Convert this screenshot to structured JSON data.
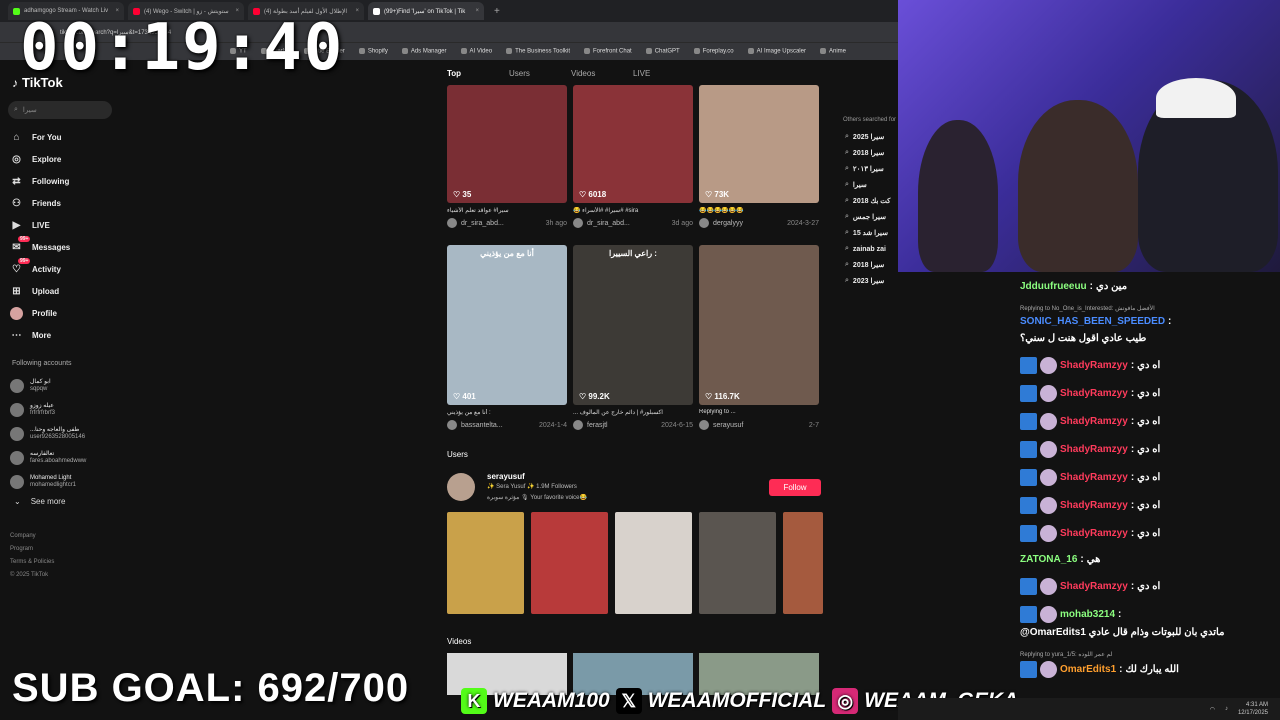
{
  "browser": {
    "tabs": [
      {
        "label": "adhamgogo Stream - Watch Liv",
        "color": "#53fc18"
      },
      {
        "label": "(4) Wego - Switch | ستويتش - زو",
        "color": "#ff0033"
      },
      {
        "label": "(4) الإطلال الأول لفيلم أسد بطولة",
        "color": "#ff0033"
      },
      {
        "label": "(99+)Find 'سيرا' on TikTok | Tik",
        "color": "#ffffff"
      }
    ],
    "address": "tiktok.com/search?q=سيرا&t=1734359384",
    "bookmarks": [
      "YT",
      "Overlay",
      "Title Builder",
      "Shopify",
      "Ads Manager",
      "AI Video",
      "The Business Toolkit",
      "Forefront Chat",
      "ChatGPT",
      "Foreplay.co",
      "AI Image Upscaler",
      "Anime"
    ]
  },
  "timer": "00:19:40",
  "tiktok": {
    "logo": "TikTok",
    "search_value": "سيرا",
    "nav": [
      {
        "label": "For You",
        "icon": "home-icon",
        "glyph": "⌂"
      },
      {
        "label": "Explore",
        "icon": "compass-icon",
        "glyph": "◎"
      },
      {
        "label": "Following",
        "icon": "following-icon",
        "glyph": "⇄"
      },
      {
        "label": "Friends",
        "icon": "friends-icon",
        "glyph": "⚇"
      },
      {
        "label": "LIVE",
        "icon": "live-icon",
        "glyph": "▶"
      },
      {
        "label": "Messages",
        "icon": "messages-icon",
        "glyph": "✉",
        "badge": "99+"
      },
      {
        "label": "Activity",
        "icon": "activity-icon",
        "glyph": "♡",
        "badge": "99+"
      },
      {
        "label": "Upload",
        "icon": "upload-icon",
        "glyph": "⊞"
      },
      {
        "label": "Profile",
        "icon": "profile-icon",
        "glyph": ""
      },
      {
        "label": "More",
        "icon": "more-icon",
        "glyph": "⋯"
      }
    ],
    "following_title": "Following accounts",
    "following": [
      {
        "name": "ابو كمال",
        "handle": "sqpqw"
      },
      {
        "name": "عيله زوزو",
        "handle": "frfrfrfrbrf3"
      },
      {
        "name": "...طفى والعاجه وحنا",
        "handle": "user9263528005146"
      },
      {
        "name": "تعالفارسه",
        "handle": "fares.aboahmedwww"
      },
      {
        "name": "Mohamed Light",
        "handle": "mohamedlightcr1"
      }
    ],
    "see_more": "See more",
    "footer": [
      "Company",
      "Program",
      "Terms & Policies",
      "© 2025 TikTok"
    ],
    "search_tabs": [
      "Top",
      "Users",
      "Videos",
      "LIVE"
    ],
    "videos": [
      {
        "likes": "35",
        "caption": "سيرا# عواقد تعلم الأشياء",
        "user": "dr_sira_abd...",
        "date": "3h ago",
        "bg": "#7a2e34"
      },
      {
        "likes": "6018",
        "caption": "😂 سيرا# #الأسراء# #sira",
        "user": "dr_sira_abd...",
        "date": "3d ago",
        "bg": "#8a3338"
      },
      {
        "likes": "73K",
        "caption": "😂😂😂😂😂😂",
        "user": "dergalyyy",
        "date": "2024-3-27",
        "bg": "#b89a86"
      },
      {
        "likes": "401",
        "caption": "أنا مع من يؤذيني :",
        "user": "bassanteltа...",
        "date": "2024-1-4",
        "bg": "#a8b8c4",
        "overlay": "أنا مع من يؤذيني"
      },
      {
        "likes": "99.2K",
        "caption": "... اكسبلور# | دائم خارج عن المألوف",
        "user": "ferasjtl",
        "date": "2024-6-15",
        "bg": "#3d3a36",
        "overlay": "راعي السييرا :"
      },
      {
        "likes": "116.7K",
        "caption": "Replying to ...",
        "user": "serayusuf",
        "date": "2-7",
        "bg": "#6f5a4e"
      }
    ],
    "users_heading": "Users",
    "user": {
      "name": "serayusuf",
      "line1": "✨ Sera Yusuf ✨ 1.9M Followers",
      "line2": "مؤثرة سوبرة 🎙 Your favorite voice😂",
      "follow": "Follow"
    },
    "videos_heading": "Videos",
    "others_title": "Others searched for",
    "others": [
      "سيرا 2025",
      "سيرا 2018",
      "سيرا ٢٠١٣",
      "سيرا",
      "2018 كت بك",
      "سيرا جمس",
      "سيرا شد 15",
      "zainab zai",
      "سيرا 2018",
      "سيرا 2023"
    ]
  },
  "chat": [
    {
      "user": "Jdduufrueeuu",
      "color": "#8cff80",
      "text": "مين دي",
      "badges": false
    },
    {
      "reply": "Replying to No_One_is_Interested: الأفضل مافوتش",
      "user": "SONIC_HAS_BEEN_SPEEDED",
      "color": "#4a8cff",
      "text": "طيب عادي اقول هنت ل سني؟",
      "badges": false
    },
    {
      "user": "ShadyRamzyy",
      "color": "#ff3b5c",
      "text": "اه دي",
      "badges": true
    },
    {
      "user": "ShadyRamzyy",
      "color": "#ff3b5c",
      "text": "اه دي",
      "badges": true
    },
    {
      "user": "ShadyRamzyy",
      "color": "#ff3b5c",
      "text": "اه دي",
      "badges": true
    },
    {
      "user": "ShadyRamzyy",
      "color": "#ff3b5c",
      "text": "اه دي",
      "badges": true
    },
    {
      "user": "ShadyRamzyy",
      "color": "#ff3b5c",
      "text": "اه دي",
      "badges": true
    },
    {
      "user": "ShadyRamzyy",
      "color": "#ff3b5c",
      "text": "اه دي",
      "badges": true
    },
    {
      "user": "ShadyRamzyy",
      "color": "#ff3b5c",
      "text": "اه دي",
      "badges": true
    },
    {
      "user": "ZATONA_16",
      "color": "#8cff80",
      "text": "هي",
      "badges": false
    },
    {
      "user": "ShadyRamzyy",
      "color": "#ff3b5c",
      "text": "اه دي",
      "badges": true
    },
    {
      "user": "mohab3214",
      "color": "#8cff80",
      "text": "@OmarEdits1 ماتدي بان للبوتات وذام قال عادي",
      "badges": true
    },
    {
      "reply": "Replying to yura_1/5: لم عمر اللوده",
      "user": "OmarEdits1",
      "color": "#ff9f2e",
      "text": "الله يبارك لك",
      "badges": true
    }
  ],
  "sub_goal": "SUB GOAL: 692/700",
  "socials": [
    {
      "handle": "WEAAM100",
      "icon": "kick-icon",
      "glyph": "K",
      "color": "#53fc18"
    },
    {
      "handle": "WEAAMOFFICIAL",
      "icon": "x-icon",
      "glyph": "𝕏",
      "color": "#000000"
    },
    {
      "handle": "WEAAM_GEKA",
      "icon": "instagram-icon",
      "glyph": "◎",
      "color": "#d62976"
    }
  ],
  "taskbar": {
    "time": "4:31 AM",
    "date": "12/17/2025"
  }
}
